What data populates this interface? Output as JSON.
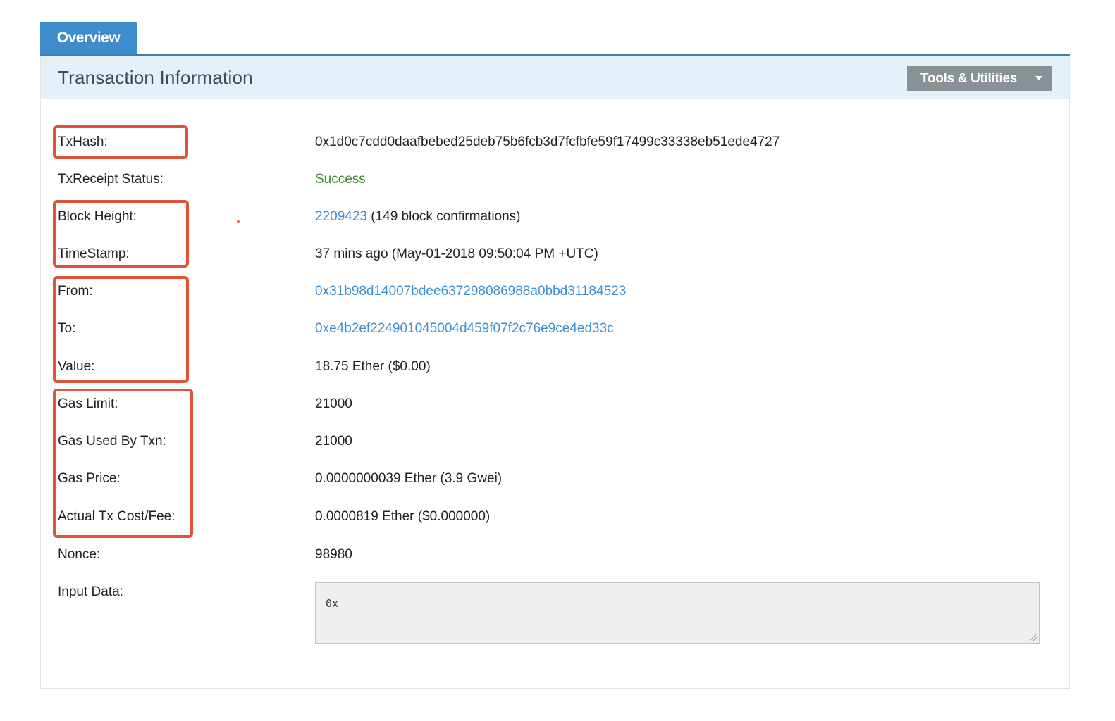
{
  "tabs": {
    "overview": "Overview"
  },
  "panel": {
    "title": "Transaction Information",
    "tools_button": "Tools & Utilities"
  },
  "rows": {
    "txhash": {
      "label": "TxHash:",
      "value": "0x1d0c7cdd0daafbebed25deb75b6fcb3d7fcfbfe59f17499c33338eb51ede4727"
    },
    "status": {
      "label": "TxReceipt Status:",
      "value": "Success"
    },
    "block": {
      "label": "Block Height:",
      "link": "2209423",
      "suffix": " (149 block confirmations)"
    },
    "timestamp": {
      "label": "TimeStamp:",
      "value": "37 mins ago (May-01-2018 09:50:04 PM +UTC)"
    },
    "from": {
      "label": "From:",
      "value": "0x31b98d14007bdee637298086988a0bbd31184523"
    },
    "to": {
      "label": "To:",
      "value": "0xe4b2ef224901045004d459f07f2c76e9ce4ed33c"
    },
    "value": {
      "label": "Value:",
      "value": "18.75 Ether ($0.00)"
    },
    "gas_limit": {
      "label": "Gas Limit:",
      "value": "21000"
    },
    "gas_used": {
      "label": "Gas Used By Txn:",
      "value": "21000"
    },
    "gas_price": {
      "label": "Gas Price:",
      "value": "0.0000000039 Ether (3.9 Gwei)"
    },
    "fee": {
      "label": "Actual Tx Cost/Fee:",
      "value": "0.0000819 Ether ($0.000000)"
    },
    "nonce": {
      "label": "Nonce:",
      "value": "98980"
    },
    "input": {
      "label": "Input Data:",
      "value": "0x"
    }
  },
  "colors": {
    "tab_bg": "#3f8ccc",
    "header_bg": "#e4f1f8",
    "link": "#3d8fd0",
    "success": "#3e8e2f",
    "highlight": "#e0523a",
    "button_bg": "#8a9195"
  }
}
